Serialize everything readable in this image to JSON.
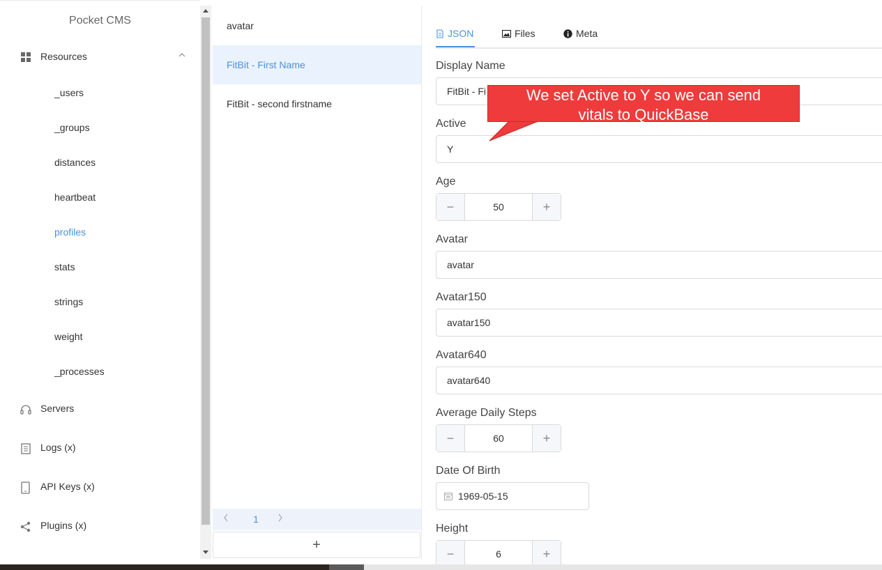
{
  "app": {
    "title": "Pocket CMS"
  },
  "sidebar": {
    "resources_label": "Resources",
    "resources": [
      "_users",
      "_groups",
      "distances",
      "heartbeat",
      "profiles",
      "stats",
      "strings",
      "weight",
      "_processes"
    ],
    "active_resource": "profiles",
    "items": [
      {
        "label": "Servers",
        "icon": "headset-icon"
      },
      {
        "label": "Logs (x)",
        "icon": "document-icon"
      },
      {
        "label": "API Keys (x)",
        "icon": "tablet-icon"
      },
      {
        "label": "Plugins (x)",
        "icon": "share-icon"
      }
    ]
  },
  "list": {
    "items": [
      "avatar",
      "FitBit - First Name",
      "FitBit - second firstname"
    ],
    "selected": "FitBit - First Name",
    "pager": {
      "prev": "<",
      "page": "1",
      "next": ">"
    },
    "add_label": "+"
  },
  "detail": {
    "tabs": [
      {
        "label": "JSON",
        "icon": "file-icon",
        "active": true
      },
      {
        "label": "Files",
        "icon": "image-icon",
        "active": false
      },
      {
        "label": "Meta",
        "icon": "info-icon",
        "active": false
      }
    ],
    "fields": {
      "display_name": {
        "label": "Display Name",
        "value": "FitBit - Fi"
      },
      "active": {
        "label": "Active",
        "value": "Y"
      },
      "age": {
        "label": "Age",
        "value": "50"
      },
      "avatar": {
        "label": "Avatar",
        "value": "avatar"
      },
      "avatar150": {
        "label": "Avatar150",
        "value": "avatar150"
      },
      "avatar640": {
        "label": "Avatar640",
        "value": "avatar640"
      },
      "average_daily_steps": {
        "label": "Average Daily Steps",
        "value": "60"
      },
      "date_of_birth": {
        "label": "Date Of Birth",
        "value": "1969-05-15"
      },
      "height": {
        "label": "Height",
        "value": "6"
      }
    },
    "stepper": {
      "minus": "−",
      "plus": "+"
    }
  },
  "callout": {
    "line1": "We set Active to Y so we can send",
    "line2": "vitals to QuickBase",
    "color": "#ef3b3b"
  },
  "colors": {
    "accent": "#4a90e2",
    "selected_bg": "#eaf3fd"
  }
}
